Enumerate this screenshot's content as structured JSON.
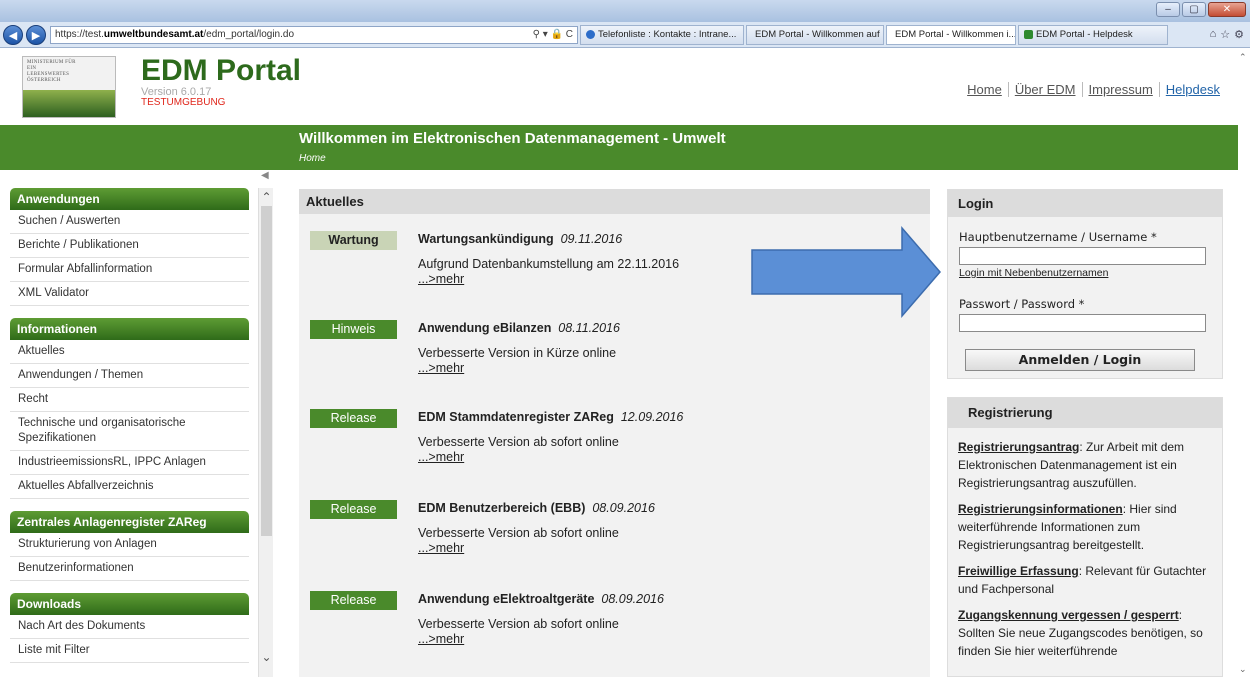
{
  "browser": {
    "url_prefix": "https://test.",
    "url_host": "umweltbundesamt.at",
    "url_path": "/edm_portal/login.do",
    "address_tools": "⚲ ▾ 🔒 C",
    "tabs": [
      {
        "label": "Telefonliste : Kontakte : Intrane...",
        "active": false
      },
      {
        "label": "EDM Portal - Willkommen auf ...",
        "active": false
      },
      {
        "label": "EDM Portal - Willkommen i...  ×",
        "active": true
      },
      {
        "label": "EDM Portal - Helpdesk",
        "active": false
      }
    ]
  },
  "header": {
    "logo_text": "MINISTERIUM FÜR EIN LEBENSWERTES ÖSTERREICH",
    "title": "EDM Portal",
    "version": "Version 6.0.17",
    "environment": "TESTUMGEBUNG",
    "links": [
      "Home",
      "Über EDM",
      "Impressum",
      "Helpdesk"
    ]
  },
  "banner": {
    "title": "Willkommen im Elektronischen Datenmanagement - Umwelt",
    "breadcrumb": "Home"
  },
  "sidebar": {
    "groups": [
      {
        "title": "Anwendungen",
        "items": [
          "Suchen / Auswerten",
          "Berichte / Publikationen",
          "Formular Abfallinformation",
          "XML Validator"
        ]
      },
      {
        "title": "Informationen",
        "items": [
          "Aktuelles",
          "Anwendungen / Themen",
          "Recht",
          "Technische und organisatorische Spezifikationen",
          "IndustrieemissionsRL, IPPC Anlagen",
          "Aktuelles Abfallverzeichnis"
        ]
      },
      {
        "title": "Zentrales Anlagenregister ZAReg",
        "items": [
          "Strukturierung von Anlagen",
          "Benutzerinformationen"
        ]
      },
      {
        "title": "Downloads",
        "items": [
          "Nach Art des Dokuments",
          "Liste mit Filter"
        ]
      }
    ]
  },
  "main": {
    "heading": "Aktuelles",
    "news": [
      {
        "badge": "Wartung",
        "title": "Wartungsankündigung",
        "date": "09.11.2016",
        "text": "Aufgrund Datenbankumstellung am 22.11.2016",
        "more": "...>mehr"
      },
      {
        "badge": "Hinweis",
        "title": "Anwendung eBilanzen",
        "date": "08.11.2016",
        "text": "Verbesserte Version in Kürze online",
        "more": "...>mehr"
      },
      {
        "badge": "Release",
        "title": "EDM Stammdatenregister ZAReg",
        "date": "12.09.2016",
        "text": "Verbesserte Version ab sofort online",
        "more": "...>mehr"
      },
      {
        "badge": "Release",
        "title": "EDM Benutzerbereich (EBB)",
        "date": "08.09.2016",
        "text": "Verbesserte Version ab sofort online",
        "more": "...>mehr"
      },
      {
        "badge": "Release",
        "title": "Anwendung eElektroaltgeräte",
        "date": "08.09.2016",
        "text": "Verbesserte Version ab sofort online",
        "more": "...>mehr"
      }
    ]
  },
  "login": {
    "heading": "Login",
    "username_label": "Hauptbenutzername / Username *",
    "username_value": "",
    "sub_user_link": "Login mit Nebenbenutzernamen",
    "password_label": "Passwort / Password *",
    "password_value": "",
    "button": "Anmelden / Login"
  },
  "registration": {
    "heading": "Registrierung",
    "items": [
      {
        "link": "Registrierungsantrag",
        "text": ": Zur Arbeit mit dem Elektronischen Datenmanagement ist ein Registrierungsantrag auszufüllen."
      },
      {
        "link": "Registrierungsinformationen",
        "text": ": Hier sind weiterführende Informationen zum Registrierungsantrag bereitgestellt."
      },
      {
        "link": "Freiwillige Erfassung",
        "text": ": Relevant für Gutachter und Fachpersonal"
      },
      {
        "link": "Zugangskennung vergessen / gesperrt",
        "text": ": Sollten Sie neue Zugangscodes benötigen, so finden Sie hier weiterführende"
      }
    ]
  },
  "colors": {
    "brand_green": "#4a8a2b",
    "env_red": "#e0261b",
    "annotation_arrow": "#5b8fd6"
  }
}
